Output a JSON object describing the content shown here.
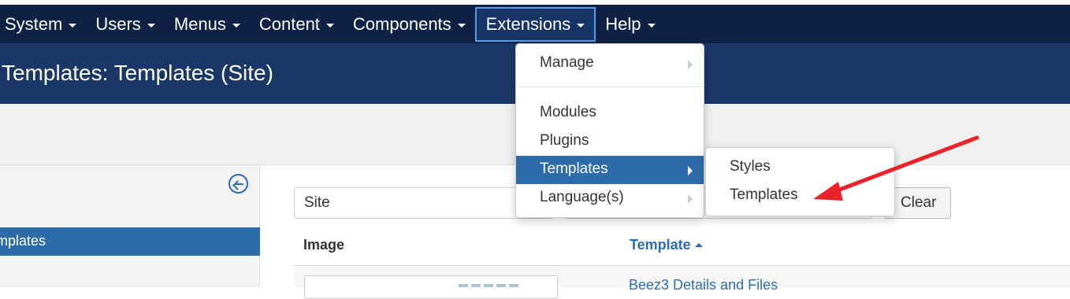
{
  "topnav": {
    "items": [
      {
        "label": "System"
      },
      {
        "label": "Users"
      },
      {
        "label": "Menus"
      },
      {
        "label": "Content"
      },
      {
        "label": "Components"
      },
      {
        "label": "Extensions"
      },
      {
        "label": "Help"
      }
    ]
  },
  "header": {
    "title": "Templates: Templates (Site)"
  },
  "sidebar": {
    "active_item": "Templates"
  },
  "filters": {
    "client_select": "Site",
    "clear_label": "Clear"
  },
  "table": {
    "columns": [
      "Image",
      "Template"
    ],
    "rows": [
      {
        "template_link": "Beez3 Details and Files"
      }
    ]
  },
  "extensions_menu": {
    "items": [
      {
        "label": "Manage"
      },
      {
        "label": "Modules"
      },
      {
        "label": "Plugins"
      },
      {
        "label": "Templates"
      },
      {
        "label": "Language(s)"
      }
    ]
  },
  "templates_submenu": {
    "items": [
      {
        "label": "Styles"
      },
      {
        "label": "Templates"
      }
    ]
  },
  "colors": {
    "topbar": "#0f2246",
    "header": "#1a3867",
    "accent": "#2d6ca9",
    "annotation_arrow": "#e8232a"
  }
}
